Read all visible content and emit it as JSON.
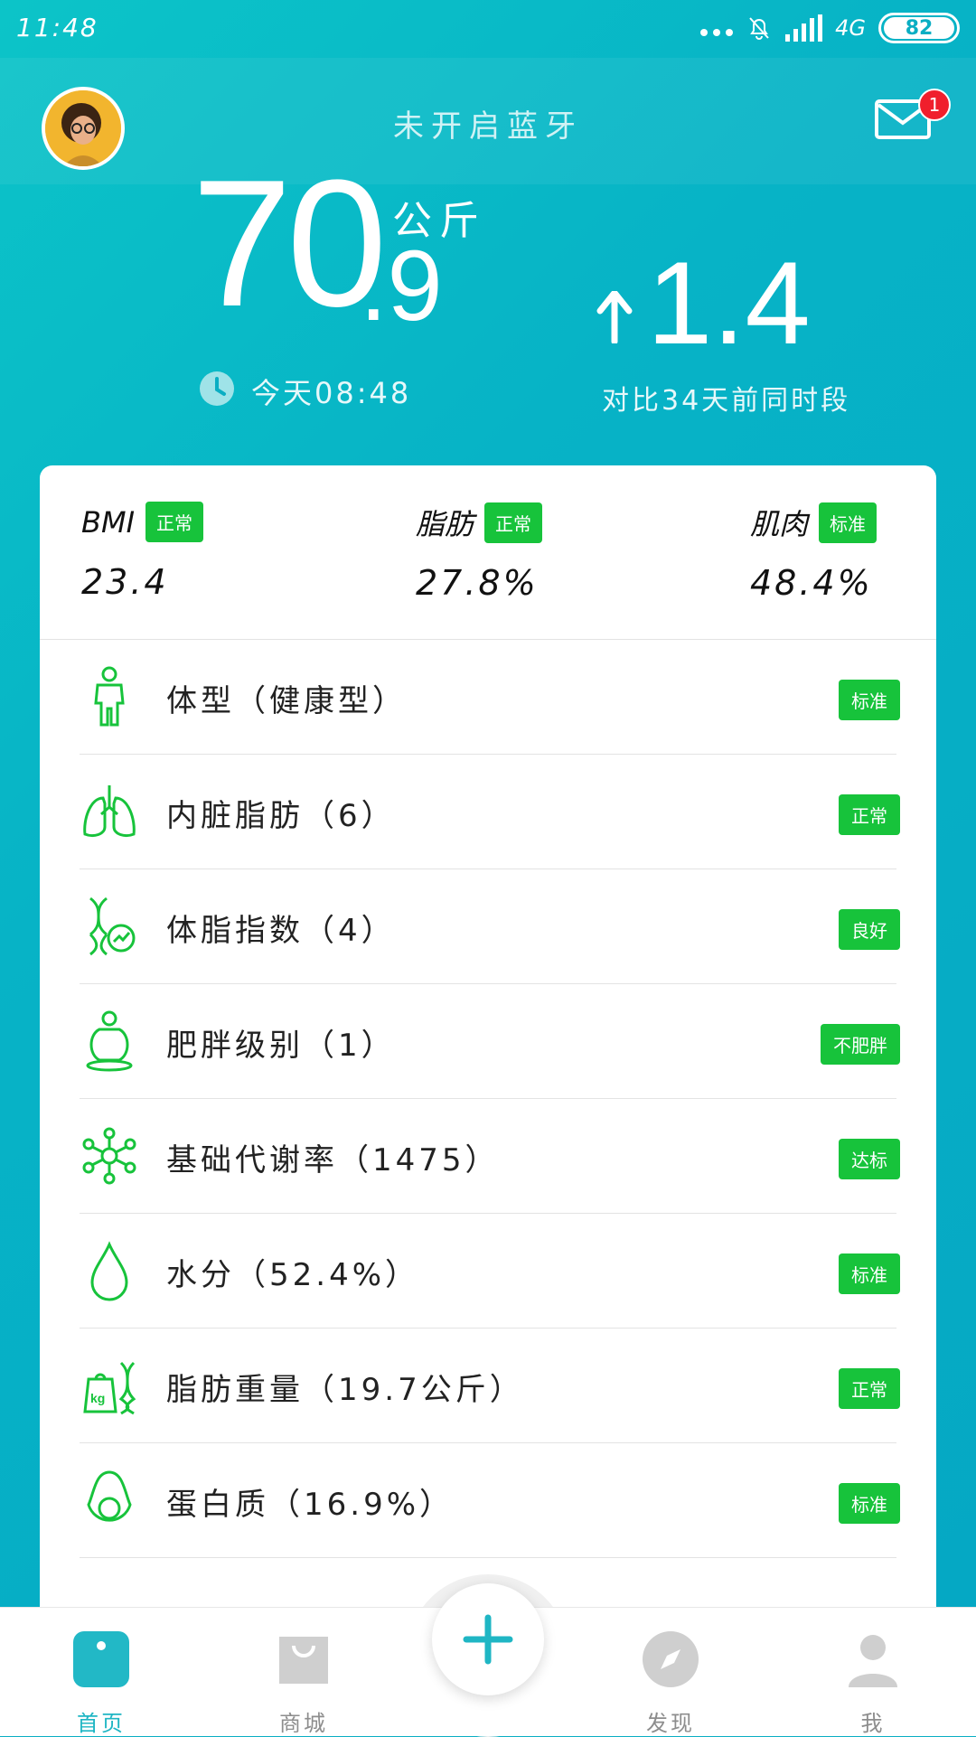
{
  "status_bar": {
    "time": "11:48",
    "network": "4G",
    "battery": "82"
  },
  "header": {
    "title": "未开启蓝牙",
    "mail_badge": "1"
  },
  "weight": {
    "integer": "70",
    "decimal": ".9",
    "unit": "公斤",
    "time": "今天08:48",
    "delta": "1.4",
    "compare": "对比34天前同时段"
  },
  "metrics": [
    {
      "label": "BMI",
      "status": "正常",
      "value": "23.4"
    },
    {
      "label": "脂肪",
      "status": "正常",
      "value": "27.8%"
    },
    {
      "label": "肌肉",
      "status": "标准",
      "value": "48.4%"
    }
  ],
  "rows": [
    {
      "icon": "body-shape-icon",
      "label": "体型（健康型）",
      "badge": "标准"
    },
    {
      "icon": "lungs-icon",
      "label": "内脏脂肪（6）",
      "badge": "正常"
    },
    {
      "icon": "dna-icon",
      "label": "体脂指数（4）",
      "badge": "良好"
    },
    {
      "icon": "obesity-icon",
      "label": "肥胖级别（1）",
      "badge": "不肥胖"
    },
    {
      "icon": "molecule-icon",
      "label": "基础代谢率（1475）",
      "badge": "达标"
    },
    {
      "icon": "water-drop-icon",
      "label": "水分（52.4%）",
      "badge": "标准"
    },
    {
      "icon": "fat-weight-icon",
      "label": "脂肪重量（19.7公斤）",
      "badge": "正常"
    },
    {
      "icon": "avocado-icon",
      "label": "蛋白质（16.9%）",
      "badge": "标准"
    }
  ],
  "nav": {
    "home": "首页",
    "shop": "商城",
    "discover": "发现",
    "me": "我"
  },
  "colors": {
    "accent": "#17c33b",
    "brand": "#0aaec3",
    "nav_active": "#1fb6c4"
  }
}
